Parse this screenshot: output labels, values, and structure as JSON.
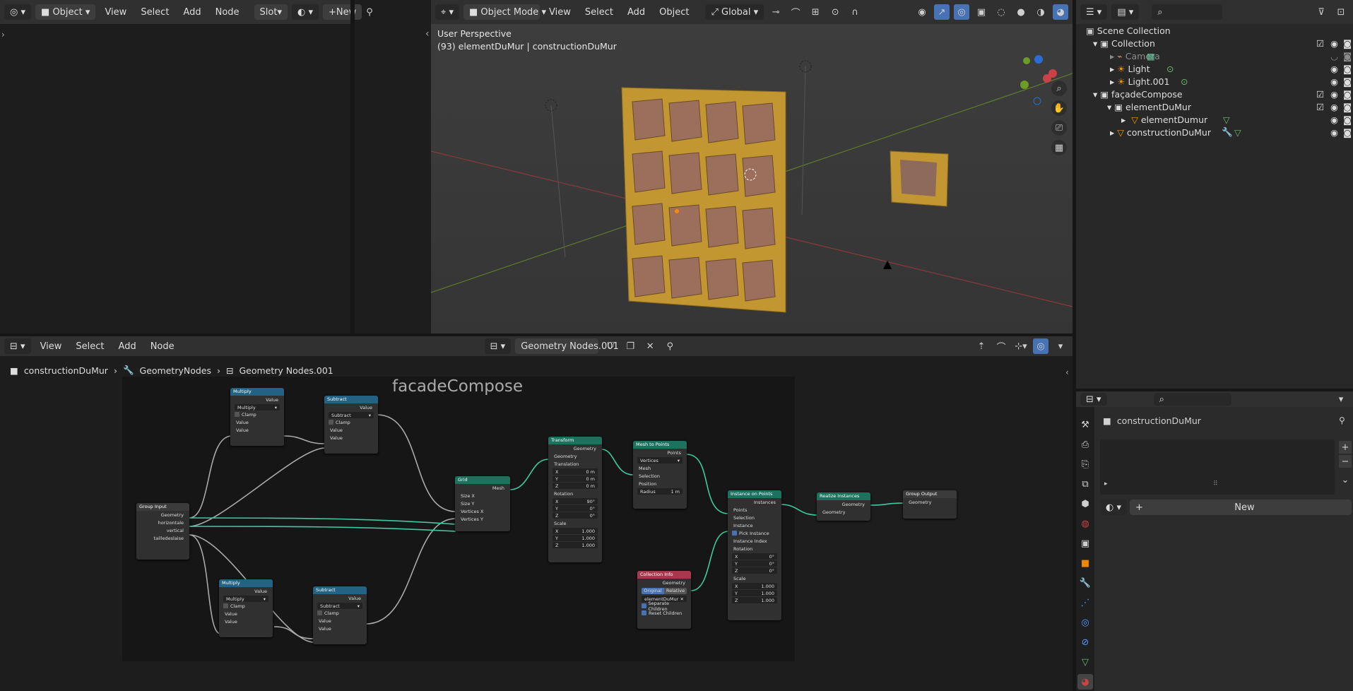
{
  "shader_editor": {
    "object_mode": "Object",
    "menus": [
      "View",
      "Select",
      "Add",
      "Node"
    ],
    "slot": "Slot",
    "new_label": "New"
  },
  "viewport": {
    "mode": "Object Mode",
    "menus": [
      "View",
      "Select",
      "Add",
      "Object"
    ],
    "orientation": "Global",
    "perspective": "User Perspective",
    "object_info": "(93) elementDuMur | constructionDuMur"
  },
  "outliner": {
    "items": [
      {
        "label": "Scene Collection",
        "icon": "scene-collection-icon"
      },
      {
        "label": "Collection",
        "icon": "collection-icon"
      },
      {
        "label": "Camera",
        "icon": "camera-icon"
      },
      {
        "label": "Light",
        "icon": "light-icon"
      },
      {
        "label": "Light.001",
        "icon": "light-icon"
      },
      {
        "label": "façadeCompose",
        "icon": "collection-icon"
      },
      {
        "label": "elementDuMur",
        "icon": "collection-icon"
      },
      {
        "label": "elementDumur",
        "icon": "mesh-icon"
      },
      {
        "label": "constructionDuMur",
        "icon": "mesh-icon"
      }
    ]
  },
  "node_editor": {
    "menus": [
      "View",
      "Select",
      "Add",
      "Node"
    ],
    "tree_name": "Geometry Nodes.001",
    "breadcrumb": [
      "constructionDuMur",
      "GeometryNodes",
      "Geometry Nodes.001"
    ],
    "frame_label": "facadeCompose",
    "nodes": {
      "group_input": {
        "title": "Group Input",
        "outputs": [
          "Geometry",
          "horizontale",
          "vertical",
          "tailledeslaise"
        ]
      },
      "multiply1": {
        "title": "Multiply",
        "output": "Value",
        "op": "Multiply",
        "clamp": "Clamp",
        "inputs": [
          "Value",
          "Value"
        ]
      },
      "subtract1": {
        "title": "Subtract",
        "output": "Value",
        "op": "Subtract",
        "clamp": "Clamp",
        "inputs": [
          "Value",
          "Value"
        ]
      },
      "multiply2": {
        "title": "Multiply",
        "output": "Value",
        "op": "Multiply",
        "clamp": "Clamp",
        "inputs": [
          "Value",
          "Value"
        ]
      },
      "subtract2": {
        "title": "Subtract",
        "output": "Value",
        "op": "Subtract",
        "clamp": "Clamp",
        "inputs": [
          "Value",
          "Value"
        ]
      },
      "grid": {
        "title": "Grid",
        "output": "Mesh",
        "inputs": [
          "Size X",
          "Size Y",
          "Vertices X",
          "Vertices Y"
        ]
      },
      "transform": {
        "title": "Transform",
        "output": "Geometry",
        "input": "Geometry",
        "translation": "Translation",
        "rotation": "Rotation",
        "scale": "Scale",
        "t": [
          "0 m",
          "0 m",
          "0 m"
        ],
        "r": [
          "90°",
          "0°",
          "0°"
        ],
        "s": [
          "1.000",
          "1.000",
          "1.000"
        ]
      },
      "mesh_to_points": {
        "title": "Mesh to Points",
        "output": "Points",
        "mode": "Vertices",
        "inputs": [
          "Mesh",
          "Selection",
          "Position"
        ],
        "radius_label": "Radius",
        "radius": "1 m"
      },
      "instance_on_points": {
        "title": "Instance on Points",
        "output": "Instances",
        "inputs": [
          "Points",
          "Selection",
          "Instance"
        ],
        "pick": "Pick Instance",
        "index": "Instance Index",
        "rotation": "Rotation",
        "scale": "Scale",
        "r": [
          "0°",
          "0°",
          "0°"
        ],
        "s": [
          "1.000",
          "1.000",
          "1.000"
        ]
      },
      "collection_info": {
        "title": "Collection Info",
        "output": "Geometry",
        "tabs": [
          "Original",
          "Relative"
        ],
        "collection": "elementDuMur",
        "opts": [
          "Separate Children",
          "Reset Children"
        ]
      },
      "realize": {
        "title": "Realize Instances",
        "output": "Geometry",
        "input": "Geometry"
      },
      "group_output": {
        "title": "Group Output",
        "input": "Geometry"
      }
    }
  },
  "properties": {
    "object_name": "constructionDuMur",
    "new_label": "New"
  },
  "axes": [
    "x",
    "y",
    "z"
  ]
}
